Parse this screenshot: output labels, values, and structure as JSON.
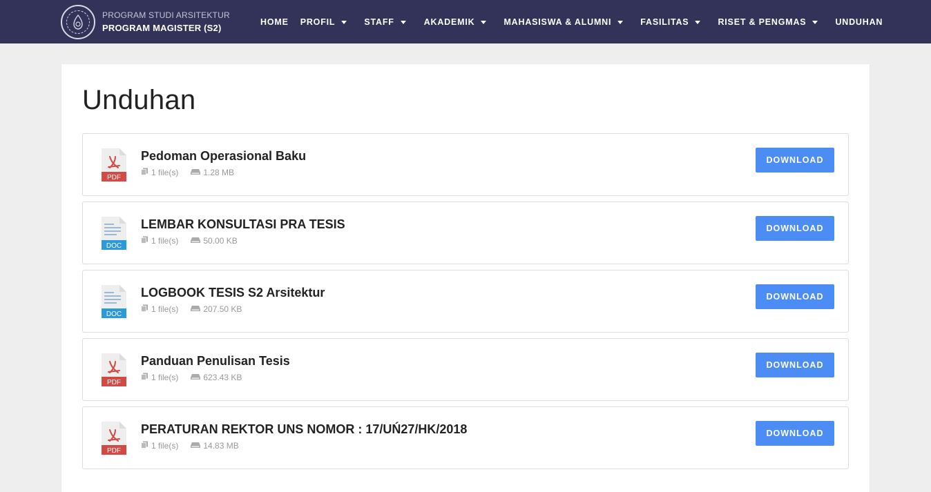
{
  "header": {
    "brand_line1": "PROGRAM STUDI ARSITEKTUR",
    "brand_line2": "PROGRAM MAGISTER (S2)",
    "logo_icon": "university-seal-icon"
  },
  "nav": [
    {
      "label": "HOME",
      "dropdown": false
    },
    {
      "label": "PROFIL",
      "dropdown": true
    },
    {
      "label": "STAFF",
      "dropdown": true
    },
    {
      "label": "AKADEMIK",
      "dropdown": true
    },
    {
      "label": "MAHASISWA & ALUMNI",
      "dropdown": true
    },
    {
      "label": "FASILITAS",
      "dropdown": true
    },
    {
      "label": "RISET & PENGMAS",
      "dropdown": true
    },
    {
      "label": "UNDUHAN",
      "dropdown": false
    }
  ],
  "page": {
    "title": "Unduhan"
  },
  "downloads": [
    {
      "title": "Pedoman Operasional Baku",
      "type": "PDF",
      "files": "1 file(s)",
      "size": "1.28 MB",
      "button": "DOWNLOAD"
    },
    {
      "title": "LEMBAR KONSULTASI PRA TESIS",
      "type": "DOC",
      "files": "1 file(s)",
      "size": "50.00 KB",
      "button": "DOWNLOAD"
    },
    {
      "title": "LOGBOOK TESIS S2 Arsitektur",
      "type": "DOC",
      "files": "1 file(s)",
      "size": "207.50 KB",
      "button": "DOWNLOAD"
    },
    {
      "title": "Panduan Penulisan Tesis",
      "type": "PDF",
      "files": "1 file(s)",
      "size": "623.43 KB",
      "button": "DOWNLOAD"
    },
    {
      "title": "PERATURAN REKTOR UNS NOMOR : 17/UŃ27/HK/2018",
      "type": "PDF",
      "files": "1 file(s)",
      "size": "14.83 MB",
      "button": "DOWNLOAD"
    }
  ],
  "colors": {
    "header_bg": "#33335a",
    "page_bg": "#eeeeee",
    "button_bg": "#4c8df5",
    "pdf_badge": "#d24a43",
    "doc_badge": "#2a9ad8"
  }
}
